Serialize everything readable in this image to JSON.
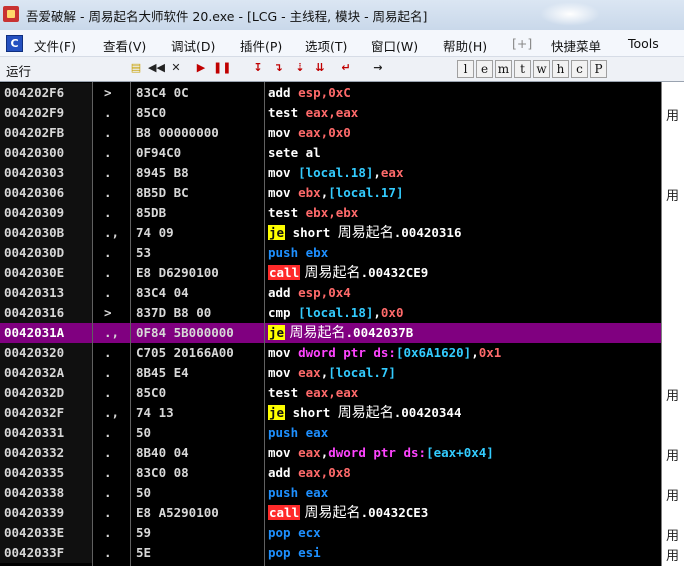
{
  "window": {
    "title": "吾爱破解 - 周易起名大师软件 20.exe - [LCG - 主线程, 模块 - 周易起名]"
  },
  "menu": [
    {
      "label": "文件(F)"
    },
    {
      "label": "查看(V)"
    },
    {
      "label": "调试(D)"
    },
    {
      "label": "插件(P)"
    },
    {
      "label": "选项(T)"
    },
    {
      "label": "窗口(W)"
    },
    {
      "label": "帮助(H)"
    },
    {
      "label": "[+]"
    },
    {
      "label": "快捷菜单"
    },
    {
      "label": "Tools"
    }
  ],
  "toolbar": {
    "run_label": "运行",
    "letters": [
      "l",
      "e",
      "m",
      "t",
      "w",
      "h",
      "c",
      "P"
    ]
  },
  "disasm": {
    "rows": [
      {
        "addr": "004202F6",
        "mark": ">",
        "hex": "83C4 0C",
        "mn": "add",
        "op": [
          [
            "num",
            "esp,"
          ],
          [
            "num",
            "0xC"
          ]
        ]
      },
      {
        "addr": "004202F9",
        "mark": ".",
        "hex": "85C0",
        "mn": "test",
        "op": [
          [
            "num",
            "eax,eax"
          ]
        ]
      },
      {
        "addr": "004202FB",
        "mark": ".",
        "hex": "B8 00000000",
        "mn": "mov",
        "op": [
          [
            "num",
            "eax,0x0"
          ]
        ]
      },
      {
        "addr": "00420300",
        "mark": ".",
        "hex": "0F94C0",
        "mn": "sete",
        "op": [
          [
            "kw",
            "al"
          ]
        ]
      },
      {
        "addr": "00420303",
        "mark": ".",
        "hex": "8945 B8",
        "mn": "mov",
        "op": [
          [
            "mem",
            "[local.18]"
          ],
          [
            "kw",
            ","
          ],
          [
            "num",
            "eax"
          ]
        ]
      },
      {
        "addr": "00420306",
        "mark": ".",
        "hex": "8B5D BC",
        "mn": "mov",
        "op": [
          [
            "num",
            "ebx"
          ],
          [
            "kw",
            ","
          ],
          [
            "mem",
            "[local.17]"
          ]
        ]
      },
      {
        "addr": "00420309",
        "mark": ".",
        "hex": "85DB",
        "mn": "test",
        "op": [
          [
            "num",
            "ebx,ebx"
          ]
        ]
      },
      {
        "addr": "0042030B",
        "mark": ".,",
        "hex": "74 09",
        "mn": "je",
        "op": [
          [
            "kw",
            " short "
          ],
          [
            "cn",
            "周易起名"
          ],
          [
            "kw",
            ".00420316"
          ]
        ]
      },
      {
        "addr": "0042030D",
        "mark": ".",
        "hex": "53",
        "mn": "push",
        "op": [
          [
            "push",
            "ebx"
          ]
        ]
      },
      {
        "addr": "0042030E",
        "mark": ".",
        "hex": "E8 D6290100",
        "mn": "call",
        "op": [
          [
            "cn",
            " 周易起名"
          ],
          [
            "kw",
            ".00432CE9"
          ]
        ]
      },
      {
        "addr": "00420313",
        "mark": ".",
        "hex": "83C4 04",
        "mn": "add",
        "op": [
          [
            "num",
            "esp,"
          ],
          [
            "num",
            "0x4"
          ]
        ]
      },
      {
        "addr": "00420316",
        "mark": ">",
        "hex": "837D B8 00",
        "mn": "cmp",
        "op": [
          [
            "mem",
            "[local.18]"
          ],
          [
            "kw",
            ","
          ],
          [
            "num",
            "0x0"
          ]
        ]
      },
      {
        "addr": "0042031A",
        "mark": ".,",
        "hex": "0F84 5B000000",
        "mn": "je",
        "sel": true,
        "op": [
          [
            "cn",
            " 周易起名"
          ],
          [
            "kw",
            ".0042037B"
          ]
        ]
      },
      {
        "addr": "00420320",
        "mark": ".",
        "hex": "C705 20166A00",
        "mn": "mov",
        "op": [
          [
            "ptr",
            "dword ptr ds:"
          ],
          [
            "mem",
            "[0x6A1620]"
          ],
          [
            "kw",
            ","
          ],
          [
            "num",
            "0x1"
          ]
        ]
      },
      {
        "addr": "0042032A",
        "mark": ".",
        "hex": "8B45 E4",
        "mn": "mov",
        "op": [
          [
            "num",
            "eax"
          ],
          [
            "kw",
            ","
          ],
          [
            "mem",
            "[local.7]"
          ]
        ]
      },
      {
        "addr": "0042032D",
        "mark": ".",
        "hex": "85C0",
        "mn": "test",
        "op": [
          [
            "num",
            "eax,eax"
          ]
        ]
      },
      {
        "addr": "0042032F",
        "mark": ".,",
        "hex": "74 13",
        "mn": "je",
        "op": [
          [
            "kw",
            " short "
          ],
          [
            "cn",
            "周易起名"
          ],
          [
            "kw",
            ".00420344"
          ]
        ]
      },
      {
        "addr": "00420331",
        "mark": ".",
        "hex": "50",
        "mn": "push",
        "op": [
          [
            "push",
            "eax"
          ]
        ]
      },
      {
        "addr": "00420332",
        "mark": ".",
        "hex": "8B40 04",
        "mn": "mov",
        "op": [
          [
            "num",
            "eax"
          ],
          [
            "kw",
            ","
          ],
          [
            "ptr",
            "dword ptr ds:"
          ],
          [
            "mem",
            "[eax+0x4]"
          ]
        ]
      },
      {
        "addr": "00420335",
        "mark": ".",
        "hex": "83C0 08",
        "mn": "add",
        "op": [
          [
            "num",
            "eax,"
          ],
          [
            "num",
            "0x8"
          ]
        ]
      },
      {
        "addr": "00420338",
        "mark": ".",
        "hex": "50",
        "mn": "push",
        "op": [
          [
            "push",
            "eax"
          ]
        ]
      },
      {
        "addr": "00420339",
        "mark": ".",
        "hex": "E8 A5290100",
        "mn": "call",
        "op": [
          [
            "cn",
            " 周易起名"
          ],
          [
            "kw",
            ".00432CE3"
          ]
        ]
      },
      {
        "addr": "0042033E",
        "mark": ".",
        "hex": "59",
        "mn": "pop",
        "op": [
          [
            "push",
            "ecx"
          ]
        ]
      },
      {
        "addr": "0042033F",
        "mark": ".",
        "hex": "5E",
        "mn": "pop",
        "op": [
          [
            "push",
            "esi"
          ]
        ]
      }
    ]
  },
  "rightpane": {
    "glyph": "用"
  },
  "colors": {
    "background": "#000000",
    "selected_row": "#800080",
    "je_highlight": "#ffff00",
    "call_highlight": "#ff2a2a",
    "memory_operand": "#33ccff",
    "numeric_operand": "#ff6a6a",
    "push_pop": "#1e90ff"
  }
}
